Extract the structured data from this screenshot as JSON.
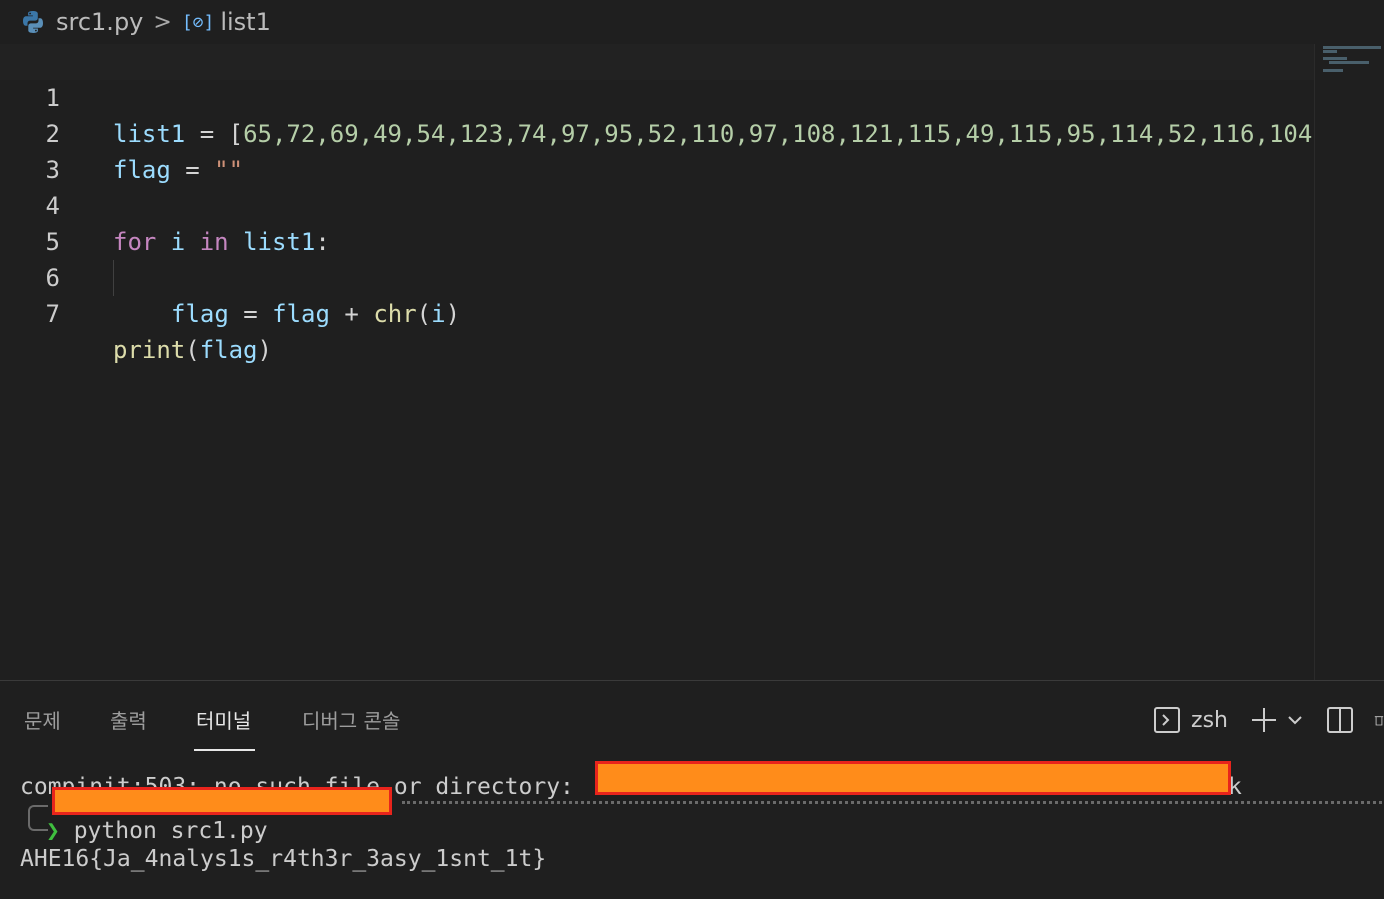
{
  "breadcrumb": {
    "file": "src1.py",
    "symbol": "list1",
    "separator": ">",
    "file_icon": "python-icon",
    "symbol_icon": "variable-icon"
  },
  "editor": {
    "lines": [
      {
        "number": "1",
        "text": "list1 = [65,72,69,49,54,123,74,97,95,52,110,97,108,121,115,49,115,95,114,52,116,104"
      },
      {
        "number": "2",
        "text": "flag = \"\""
      },
      {
        "number": "3",
        "text": ""
      },
      {
        "number": "4",
        "text": "for i in list1:"
      },
      {
        "number": "5",
        "text": "    flag = flag + chr(i)"
      },
      {
        "number": "6",
        "text": ""
      },
      {
        "number": "7",
        "text": "print(flag)"
      }
    ],
    "tokens": {
      "l1_var": "list1",
      "l1_op": " = ",
      "l1_open": "[",
      "l1_nums": "65,72,69,49,54,123,74,97,95,52,110,97,108,121,115,49,115,95,114,52,116,104",
      "l2_var": "flag",
      "l2_op": " = ",
      "l2_str": "\"\"",
      "l4_for": "for",
      "l4_i": " i ",
      "l4_in": "in",
      "l4_list": " list1",
      "l4_colon": ":",
      "l5_flag": "flag",
      "l5_eq": " = ",
      "l5_flag2": "flag",
      "l5_plus": " + ",
      "l5_chr": "chr",
      "l5_open": "(",
      "l5_i": "i",
      "l5_close": ")",
      "l7_print": "print",
      "l7_open": "(",
      "l7_flag": "flag",
      "l7_close": ")"
    }
  },
  "panel": {
    "tabs": [
      "문제",
      "출력",
      "터미널",
      "디버그 콘솔"
    ],
    "active_tab": "터미널",
    "shell": "zsh",
    "shell_icon": "terminal-icon",
    "actions": [
      "add-icon",
      "chevron-down-icon",
      "split-icon",
      "trash-icon"
    ]
  },
  "terminal": {
    "error_line": "compinit:503: no such file or directory: ",
    "error_tail": "k",
    "prompt_symbol": "❯",
    "command": " python src1.py",
    "output": "AHE16{Ja_4nalys1s_r4th3r_3asy_1snt_1t}"
  },
  "colors": {
    "background": "#1f1f1f",
    "redaction_fill": "#ff8c1a",
    "redaction_border": "#e8241c",
    "prompt_green": "#3fbf3f"
  }
}
